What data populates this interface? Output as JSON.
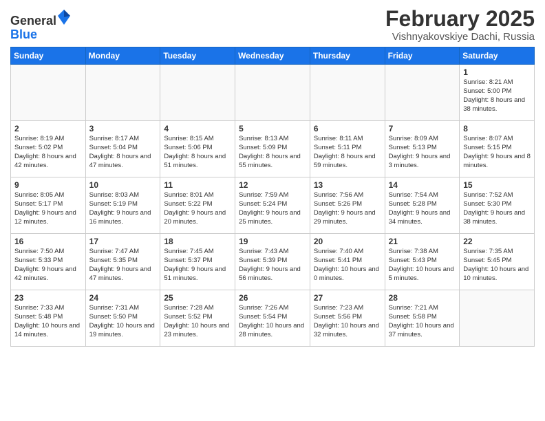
{
  "logo": {
    "general": "General",
    "blue": "Blue"
  },
  "header": {
    "month": "February 2025",
    "location": "Vishnyakovskiye Dachi, Russia"
  },
  "weekdays": [
    "Sunday",
    "Monday",
    "Tuesday",
    "Wednesday",
    "Thursday",
    "Friday",
    "Saturday"
  ],
  "weeks": [
    [
      {
        "day": "",
        "info": ""
      },
      {
        "day": "",
        "info": ""
      },
      {
        "day": "",
        "info": ""
      },
      {
        "day": "",
        "info": ""
      },
      {
        "day": "",
        "info": ""
      },
      {
        "day": "",
        "info": ""
      },
      {
        "day": "1",
        "info": "Sunrise: 8:21 AM\nSunset: 5:00 PM\nDaylight: 8 hours and 38 minutes."
      }
    ],
    [
      {
        "day": "2",
        "info": "Sunrise: 8:19 AM\nSunset: 5:02 PM\nDaylight: 8 hours and 42 minutes."
      },
      {
        "day": "3",
        "info": "Sunrise: 8:17 AM\nSunset: 5:04 PM\nDaylight: 8 hours and 47 minutes."
      },
      {
        "day": "4",
        "info": "Sunrise: 8:15 AM\nSunset: 5:06 PM\nDaylight: 8 hours and 51 minutes."
      },
      {
        "day": "5",
        "info": "Sunrise: 8:13 AM\nSunset: 5:09 PM\nDaylight: 8 hours and 55 minutes."
      },
      {
        "day": "6",
        "info": "Sunrise: 8:11 AM\nSunset: 5:11 PM\nDaylight: 8 hours and 59 minutes."
      },
      {
        "day": "7",
        "info": "Sunrise: 8:09 AM\nSunset: 5:13 PM\nDaylight: 9 hours and 3 minutes."
      },
      {
        "day": "8",
        "info": "Sunrise: 8:07 AM\nSunset: 5:15 PM\nDaylight: 9 hours and 8 minutes."
      }
    ],
    [
      {
        "day": "9",
        "info": "Sunrise: 8:05 AM\nSunset: 5:17 PM\nDaylight: 9 hours and 12 minutes."
      },
      {
        "day": "10",
        "info": "Sunrise: 8:03 AM\nSunset: 5:19 PM\nDaylight: 9 hours and 16 minutes."
      },
      {
        "day": "11",
        "info": "Sunrise: 8:01 AM\nSunset: 5:22 PM\nDaylight: 9 hours and 20 minutes."
      },
      {
        "day": "12",
        "info": "Sunrise: 7:59 AM\nSunset: 5:24 PM\nDaylight: 9 hours and 25 minutes."
      },
      {
        "day": "13",
        "info": "Sunrise: 7:56 AM\nSunset: 5:26 PM\nDaylight: 9 hours and 29 minutes."
      },
      {
        "day": "14",
        "info": "Sunrise: 7:54 AM\nSunset: 5:28 PM\nDaylight: 9 hours and 34 minutes."
      },
      {
        "day": "15",
        "info": "Sunrise: 7:52 AM\nSunset: 5:30 PM\nDaylight: 9 hours and 38 minutes."
      }
    ],
    [
      {
        "day": "16",
        "info": "Sunrise: 7:50 AM\nSunset: 5:33 PM\nDaylight: 9 hours and 42 minutes."
      },
      {
        "day": "17",
        "info": "Sunrise: 7:47 AM\nSunset: 5:35 PM\nDaylight: 9 hours and 47 minutes."
      },
      {
        "day": "18",
        "info": "Sunrise: 7:45 AM\nSunset: 5:37 PM\nDaylight: 9 hours and 51 minutes."
      },
      {
        "day": "19",
        "info": "Sunrise: 7:43 AM\nSunset: 5:39 PM\nDaylight: 9 hours and 56 minutes."
      },
      {
        "day": "20",
        "info": "Sunrise: 7:40 AM\nSunset: 5:41 PM\nDaylight: 10 hours and 0 minutes."
      },
      {
        "day": "21",
        "info": "Sunrise: 7:38 AM\nSunset: 5:43 PM\nDaylight: 10 hours and 5 minutes."
      },
      {
        "day": "22",
        "info": "Sunrise: 7:35 AM\nSunset: 5:45 PM\nDaylight: 10 hours and 10 minutes."
      }
    ],
    [
      {
        "day": "23",
        "info": "Sunrise: 7:33 AM\nSunset: 5:48 PM\nDaylight: 10 hours and 14 minutes."
      },
      {
        "day": "24",
        "info": "Sunrise: 7:31 AM\nSunset: 5:50 PM\nDaylight: 10 hours and 19 minutes."
      },
      {
        "day": "25",
        "info": "Sunrise: 7:28 AM\nSunset: 5:52 PM\nDaylight: 10 hours and 23 minutes."
      },
      {
        "day": "26",
        "info": "Sunrise: 7:26 AM\nSunset: 5:54 PM\nDaylight: 10 hours and 28 minutes."
      },
      {
        "day": "27",
        "info": "Sunrise: 7:23 AM\nSunset: 5:56 PM\nDaylight: 10 hours and 32 minutes."
      },
      {
        "day": "28",
        "info": "Sunrise: 7:21 AM\nSunset: 5:58 PM\nDaylight: 10 hours and 37 minutes."
      },
      {
        "day": "",
        "info": ""
      }
    ]
  ]
}
